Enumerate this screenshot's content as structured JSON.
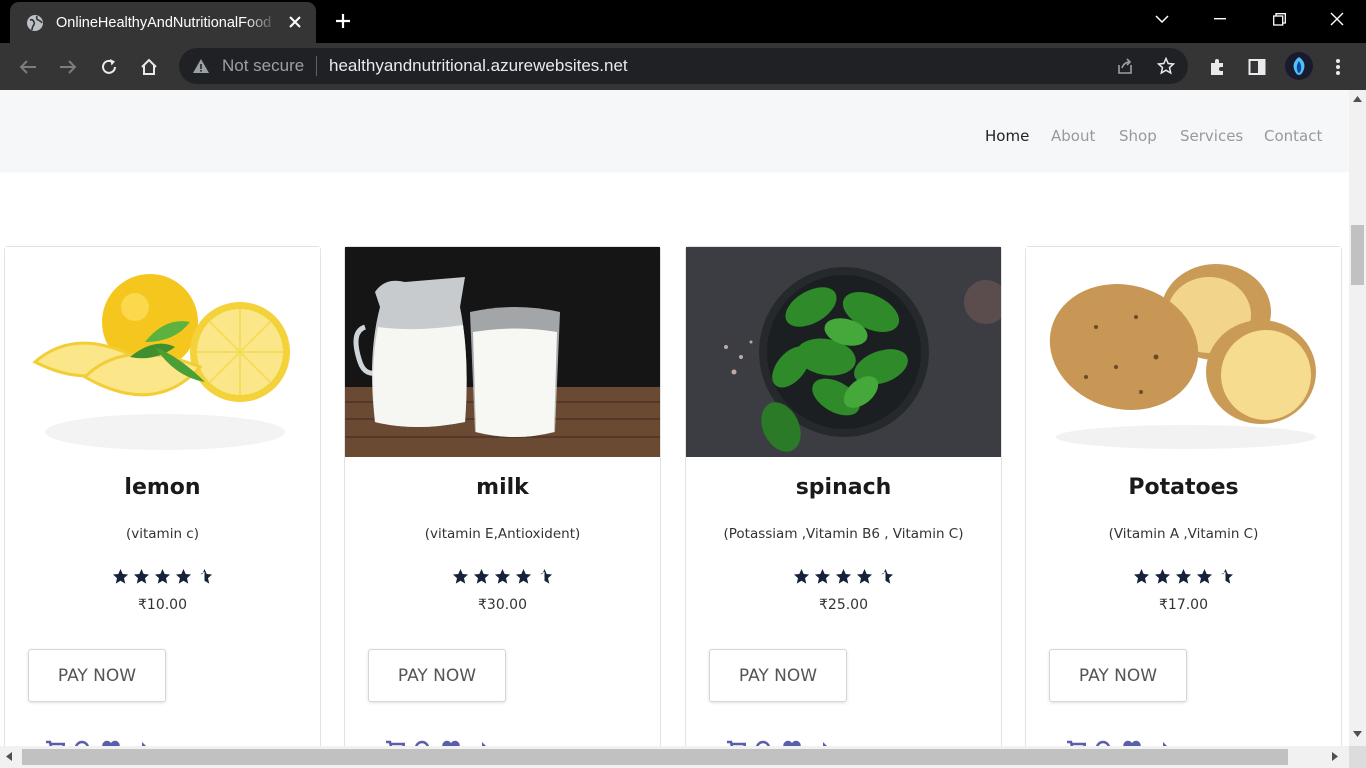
{
  "browser": {
    "tab_title": "OnlineHealthyAndNutritionalFood",
    "security_label": "Not secure",
    "url": "healthyandnutritional.azurewebsites.net"
  },
  "nav": {
    "items": [
      {
        "label": "Home"
      },
      {
        "label": "About"
      },
      {
        "label": "Shop"
      },
      {
        "label": "Services"
      },
      {
        "label": "Contact"
      }
    ],
    "active": "Home"
  },
  "products": [
    {
      "name": "lemon",
      "desc": "(vitamin c)",
      "price": "₹10.00",
      "rating": 4.5,
      "button": "PAY NOW",
      "image_icon": "lemon-image"
    },
    {
      "name": "milk",
      "desc": "(vitamin E,Antioxident)",
      "price": "₹30.00",
      "rating": 4.5,
      "button": "PAY NOW",
      "image_icon": "milk-image"
    },
    {
      "name": "spinach",
      "desc": "(Potassiam ,Vitamin B6 , Vitamin C)",
      "price": "₹25.00",
      "rating": 4.5,
      "button": "PAY NOW",
      "image_icon": "spinach-image"
    },
    {
      "name": "Potatoes",
      "desc": "(Vitamin A ,Vitamin C)",
      "price": "₹17.00",
      "rating": 4.5,
      "button": "PAY NOW",
      "image_icon": "potato-image"
    }
  ],
  "colors": {
    "star": "#16213a",
    "action_icon": "#5b5ea8",
    "nav_active": "#222222",
    "nav_inactive": "#999999"
  }
}
